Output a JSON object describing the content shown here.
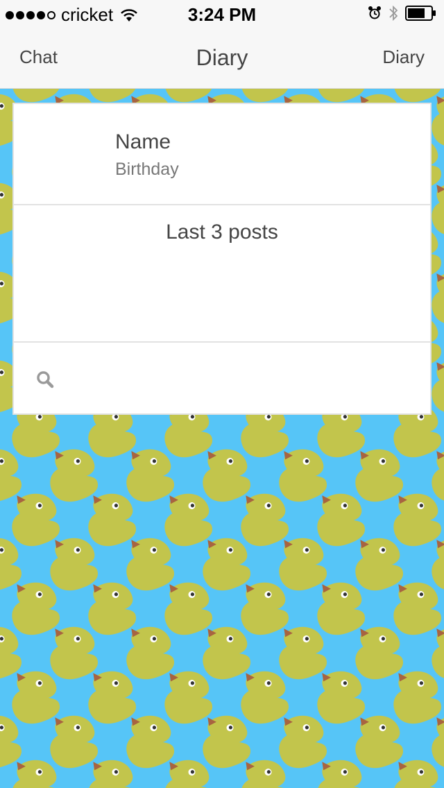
{
  "status_bar": {
    "carrier": "cricket",
    "time": "3:24 PM",
    "signal_bars_filled": 4,
    "signal_bars_total": 5,
    "battery_level": 0.75
  },
  "nav": {
    "left_label": "Chat",
    "title": "Diary",
    "right_label": "Diary"
  },
  "profile": {
    "name": "Name",
    "birthday": "Birthday"
  },
  "posts": {
    "title": "Last 3 posts"
  },
  "search": {
    "icon": "search-icon",
    "placeholder": ""
  },
  "colors": {
    "background": "#56c5f7",
    "duck": "#c2c54c",
    "beak": "#a86440"
  }
}
